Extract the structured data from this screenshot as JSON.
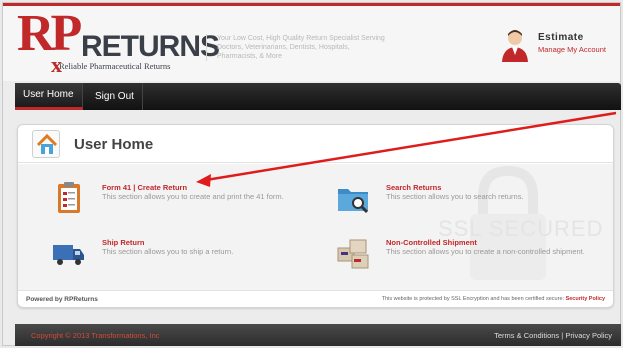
{
  "header": {
    "logo": {
      "rp": "RP",
      "x": "x",
      "returns": "RETURNS",
      "tagline": "Reliable Pharmaceutical Returns"
    },
    "description": "Your Low Cost, High Quality Return Specialist Serving Doctors, Veterinarians, Dentists, Hospitals, Pharmacists, & More",
    "account_name": "Estimate",
    "account_link": "Manage My Account"
  },
  "nav": {
    "items": [
      {
        "label": "User Home",
        "active": true
      },
      {
        "label": "Sign Out",
        "active": false
      }
    ]
  },
  "page": {
    "title": "User Home",
    "watermark": "SSL SECURED",
    "sections": [
      {
        "title": "Form 41 | Create Return",
        "desc": "This section allows you to create and print the 41 form.",
        "icon": "clipboard-form-icon"
      },
      {
        "title": "Search Returns",
        "desc": "This section allows you to search returns.",
        "icon": "folder-search-icon"
      },
      {
        "title": "Ship Return",
        "desc": "This section allows you to ship a return.",
        "icon": "truck-icon"
      },
      {
        "title": "Non-Controlled Shipment",
        "desc": "This section allows you to create a non-controlled shipment.",
        "icon": "boxes-icon"
      }
    ],
    "powered_by": "Powered by RPReturns",
    "ssl_note": "This website is protected by SSL Encryption and has been certified secure:",
    "security_policy": "Security Policy"
  },
  "footer": {
    "copyright": "Copyright © 2013 Transformations, Inc",
    "terms": "Terms & Conditions",
    "separator": "|",
    "privacy": "Privacy Policy"
  },
  "colors": {
    "brand_red": "#c0282a",
    "nav_dark": "#1c1c1c"
  }
}
